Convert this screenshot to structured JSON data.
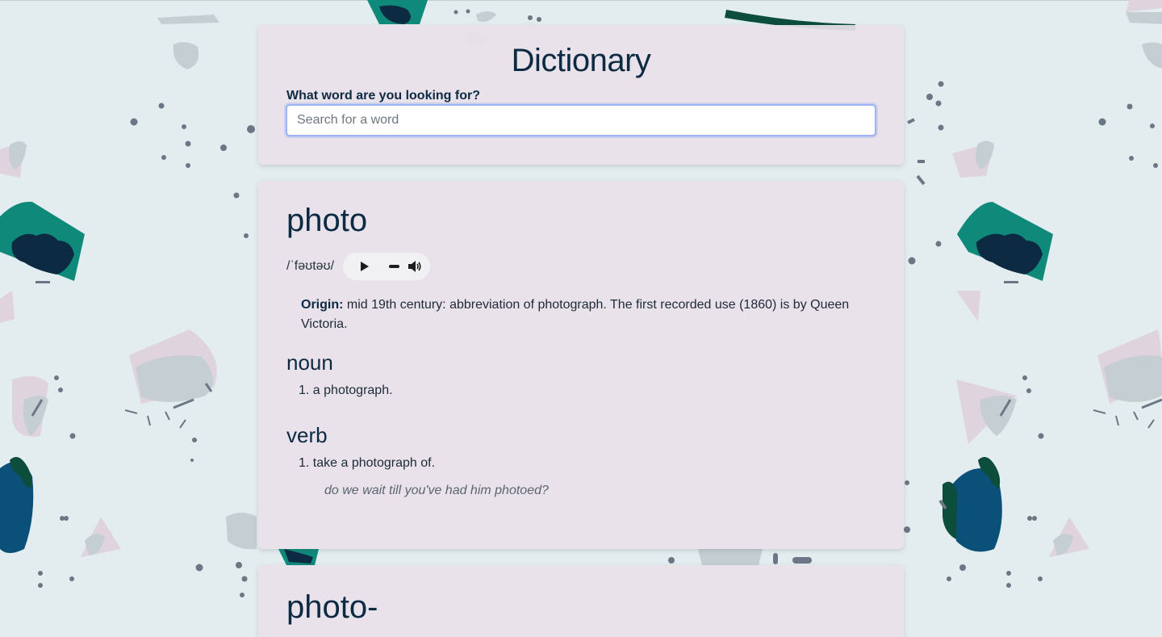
{
  "app": {
    "title": "Dictionary"
  },
  "search": {
    "label": "What word are you looking for?",
    "placeholder": "Search for a word",
    "value": ""
  },
  "entries": [
    {
      "word": "photo",
      "phonetic": "/ˈfəʊtəʊ/",
      "origin_label": "Origin:",
      "origin_text": "mid 19th century: abbreviation of photograph. The first recorded use (1860) is by Queen Victoria.",
      "meanings": [
        {
          "part_of_speech": "noun",
          "definitions": [
            {
              "number": "1.",
              "text": "a photograph."
            }
          ]
        },
        {
          "part_of_speech": "verb",
          "definitions": [
            {
              "number": "1.",
              "text": "take a photograph of.",
              "example": "do we wait till you've had him photoed?"
            }
          ]
        }
      ]
    },
    {
      "word": "photo-"
    }
  ],
  "icons": {
    "play": "play-icon",
    "volume": "volume-icon"
  },
  "colors": {
    "background": "#e3edef",
    "card": "#e9e1e9",
    "text": "#0d2a43",
    "input_border": "#9db3f2"
  }
}
